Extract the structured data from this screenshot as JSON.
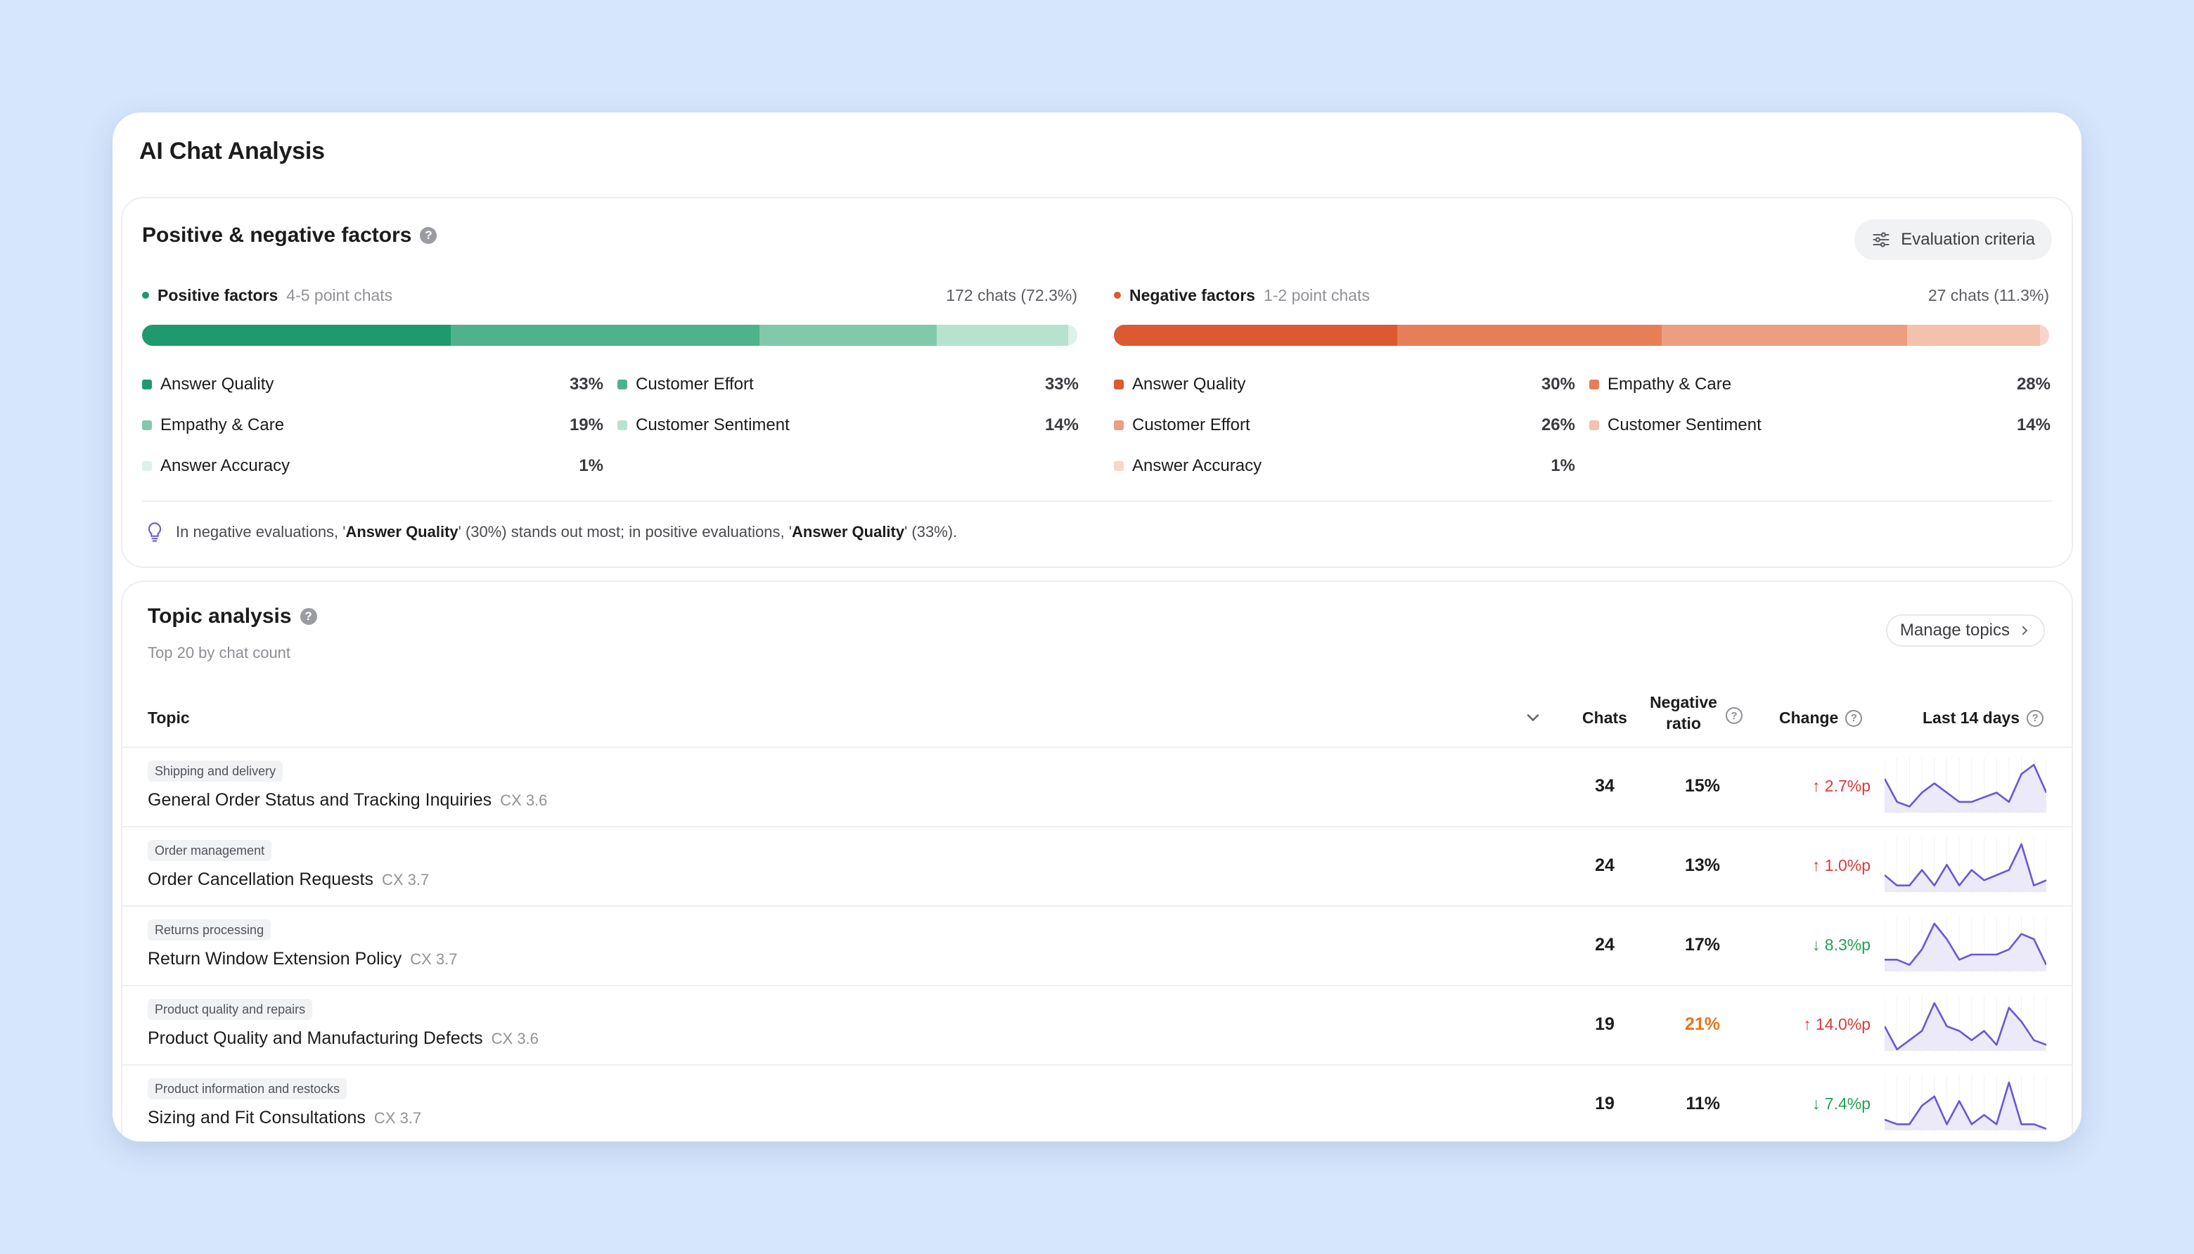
{
  "title": "AI Chat Analysis",
  "colors": {
    "positive": [
      "#1e9a6e",
      "#4fb28c",
      "#82c9ac",
      "#b6e2d0",
      "#dcf1e8"
    ],
    "negative": [
      "#db5a32",
      "#e67f58",
      "#ec9e80",
      "#f4c1ac",
      "#f7d6c9"
    ],
    "up": "#d93b3b",
    "down": "#25a050",
    "warn": "#e8741e",
    "spark": "#6c56d6",
    "spark_fill": "#ece9f8"
  },
  "factors": {
    "title": "Positive & negative factors",
    "evaluation_button": "Evaluation criteria",
    "positive": {
      "label": "Positive factors",
      "sub": "4-5 point chats",
      "count": "172 chats (72.3%)",
      "items": [
        {
          "label": "Answer Quality",
          "pct": "33%",
          "value": 33
        },
        {
          "label": "Customer Effort",
          "pct": "33%",
          "value": 33
        },
        {
          "label": "Empathy & Care",
          "pct": "19%",
          "value": 19
        },
        {
          "label": "Customer Sentiment",
          "pct": "14%",
          "value": 14
        },
        {
          "label": "Answer Accuracy",
          "pct": "1%",
          "value": 1
        }
      ]
    },
    "negative": {
      "label": "Negative factors",
      "sub": "1-2 point chats",
      "count": "27 chats (11.3%)",
      "items": [
        {
          "label": "Answer Quality",
          "pct": "30%",
          "value": 30
        },
        {
          "label": "Empathy & Care",
          "pct": "28%",
          "value": 28
        },
        {
          "label": "Customer Effort",
          "pct": "26%",
          "value": 26
        },
        {
          "label": "Customer Sentiment",
          "pct": "14%",
          "value": 14
        },
        {
          "label": "Answer Accuracy",
          "pct": "1%",
          "value": 1
        }
      ]
    },
    "insight": {
      "p1": "In negative evaluations, '",
      "b1": "Answer Quality",
      "p2": "' (30%) stands out most; in positive evaluations, '",
      "b2": "Answer Quality",
      "p3": "' (33%)."
    }
  },
  "topics": {
    "title": "Topic analysis",
    "subtitle": "Top 20 by chat count",
    "manage_button": "Manage topics",
    "columns": {
      "topic": "Topic",
      "chats": "Chats",
      "neg_ratio_line1": "Negative",
      "neg_ratio_line2": "ratio",
      "change": "Change",
      "last14": "Last 14 days"
    },
    "rows": [
      {
        "category": "Shipping and delivery",
        "name": "General Order Status and Tracking Inquiries",
        "cx": "CX 3.6",
        "chats": "34",
        "neg": "15%",
        "neg_warn": false,
        "change": "↑ 2.7%p",
        "dir": "up",
        "trend": [
          7,
          2,
          1,
          4,
          6,
          4,
          2,
          2,
          3,
          4,
          2,
          8,
          10,
          4
        ]
      },
      {
        "category": "Order management",
        "name": "Order Cancellation Requests",
        "cx": "CX 3.7",
        "chats": "24",
        "neg": "13%",
        "neg_warn": false,
        "change": "↑ 1.0%p",
        "dir": "up",
        "trend": [
          3,
          1,
          1,
          4,
          1,
          5,
          1,
          4,
          2,
          3,
          4,
          9,
          1,
          2
        ]
      },
      {
        "category": "Returns processing",
        "name": "Return Window Extension Policy",
        "cx": "CX 3.7",
        "chats": "24",
        "neg": "17%",
        "neg_warn": false,
        "change": "↓ 8.3%p",
        "dir": "down",
        "trend": [
          2,
          2,
          1,
          4,
          9,
          6,
          2,
          3,
          3,
          3,
          4,
          7,
          6,
          1
        ]
      },
      {
        "category": "Product quality and repairs",
        "name": "Product Quality and Manufacturing Defects",
        "cx": "CX 3.6",
        "chats": "19",
        "neg": "21%",
        "neg_warn": true,
        "change": "↑ 14.0%p",
        "dir": "up",
        "trend": [
          5,
          0,
          2,
          4,
          10,
          5,
          4,
          2,
          4,
          1,
          9,
          6,
          2,
          1
        ]
      },
      {
        "category": "Product information and restocks",
        "name": "Sizing and Fit Consultations",
        "cx": "CX 3.7",
        "chats": "19",
        "neg": "11%",
        "neg_warn": false,
        "change": "↓ 7.4%p",
        "dir": "down",
        "trend": [
          2,
          1,
          1,
          5,
          7,
          1,
          6,
          1,
          3,
          1,
          10,
          1,
          1,
          0
        ]
      }
    ]
  }
}
